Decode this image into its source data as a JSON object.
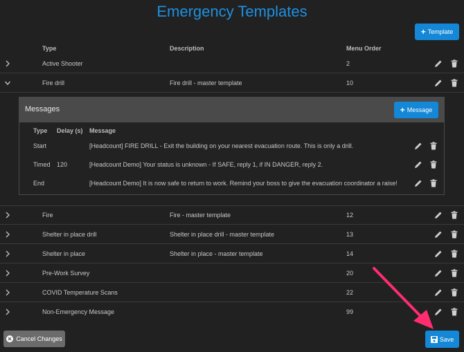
{
  "page": {
    "title": "Emergency Templates"
  },
  "toolbar": {
    "add_template_label": "Template"
  },
  "columns": {
    "type": "Type",
    "description": "Description",
    "menu_order": "Menu Order"
  },
  "rows": [
    {
      "type": "Active Shooter",
      "description": "",
      "order": "2"
    },
    {
      "type": "Fire drill",
      "description": "Fire drill - master template",
      "order": "10"
    },
    {
      "type": "Fire",
      "description": "Fire - master template",
      "order": "12"
    },
    {
      "type": "Shelter in place drill",
      "description": "Shelter in place drill - master template",
      "order": "13"
    },
    {
      "type": "Shelter in place",
      "description": "Shelter in place - master template",
      "order": "14"
    },
    {
      "type": "Pre-Work Survey",
      "description": "",
      "order": "20"
    },
    {
      "type": "COVID Temperature Scans",
      "description": "",
      "order": "22"
    },
    {
      "type": "Non-Emergency Message",
      "description": "",
      "order": "99"
    }
  ],
  "messages": {
    "title": "Messages",
    "add_label": "Message",
    "columns": {
      "type": "Type",
      "delay": "Delay (s)",
      "message": "Message"
    },
    "items": [
      {
        "type": "Start",
        "delay": "",
        "message": "[Headcount] FIRE DRILL - Exit the building on your nearest evacuation route. This is only a drill."
      },
      {
        "type": "Timed",
        "delay": "120",
        "message": "[Headcount Demo] Your status is unknown - If SAFE, reply 1, if IN DANGER, reply 2."
      },
      {
        "type": "End",
        "delay": "",
        "message": "[Headcount Demo] It is now safe to return to work. Remind your boss to give the evacuation coordinator a raise!"
      }
    ]
  },
  "footer": {
    "cancel_label": "Cancel Changes",
    "save_label": "Save"
  },
  "colors": {
    "accent": "#1487d6",
    "title": "#1e90e0",
    "arrow": "#ff2d6f",
    "background": "#212121"
  },
  "icons": [
    "plus-icon",
    "chevron-right-icon",
    "chevron-down-icon",
    "pencil-icon",
    "trash-icon",
    "cancel-circle-icon",
    "save-disk-icon"
  ]
}
